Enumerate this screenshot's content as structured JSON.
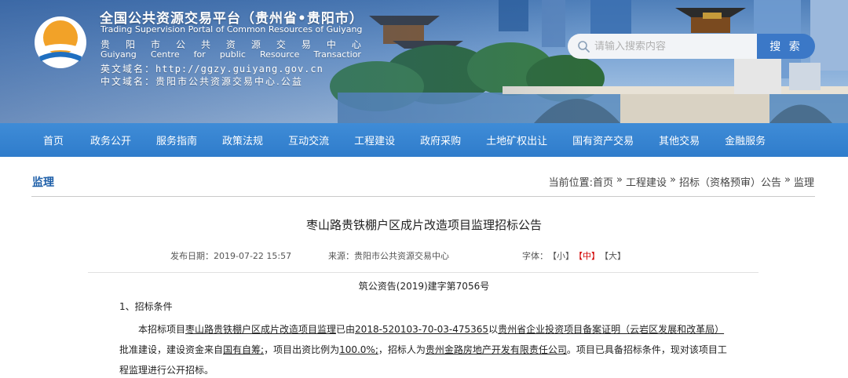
{
  "header": {
    "title_cn": "全国公共资源交易平台（贵州省•贵阳市）",
    "title_en": "Trading Supervision Portal of Common Resources of Guiyang",
    "center_cn": [
      "贵",
      "阳",
      "市",
      "公",
      "共",
      "资",
      "源",
      "交",
      "易",
      "中",
      "心"
    ],
    "center_en": [
      "Guiyang",
      "Centre",
      "for",
      "public",
      "Resource",
      "Transactior"
    ],
    "en_domain_label": "英文域名：",
    "en_domain_value": "http://ggzy.guiyang.gov.cn",
    "cn_domain_label": "中文域名：",
    "cn_domain_value": "贵阳市公共资源交易中心.公益"
  },
  "search": {
    "placeholder": "请输入搜索内容",
    "button_label": "搜 索"
  },
  "nav": [
    "首页",
    "政务公开",
    "服务指南",
    "政策法规",
    "互动交流",
    "工程建设",
    "政府采购",
    "土地矿权出让",
    "国有资产交易",
    "其他交易",
    "金融服务"
  ],
  "section": {
    "title": "监理"
  },
  "breadcrumb": {
    "prefix": "当前位置:",
    "items": [
      "首页",
      "»",
      "工程建设",
      "»",
      "招标（资格预审）公告",
      "»",
      "监理"
    ]
  },
  "article": {
    "title": "枣山路贵铁棚户区成片改造项目监理招标公告",
    "publish_label": "发布日期：",
    "publish_value": "2019-07-22 15:57",
    "source_label": "来源：",
    "source_value": "贵阳市公共资源交易中心",
    "font_label": "字体：",
    "font_small": "【小】",
    "font_medium": "【中】",
    "font_large": "【大】",
    "doc_no": "筑公资告(2019)建字第7056号",
    "section1": "1、招标条件",
    "p1": "本招标项目",
    "p2": "枣山路贵铁棚户区成片改造项目监理",
    "p3": "已由",
    "p4": "2018-520103-70-03-475365",
    "p5": "以",
    "p6": "贵州省企业投资项目备案证明（云岩区发展和改革局）",
    "p7": "批准建设，建设资金来自",
    "p8": "国有自筹;",
    "p9": "，项目出资比例为",
    "p10": "100.0%;",
    "p11": "，招标人为",
    "p12": "贵州金路房地产开发有限责任公司",
    "p13": "。项目已具备招标条件，现对该项目工程监理进行公开招标。"
  },
  "colors": {
    "nav_bg": "#2f7ccb",
    "search_button": "#3b78c7",
    "section_title": "#1d5ea8",
    "active_font_size": "#d20000"
  },
  "icons": [
    "logo-emblem",
    "search-icon"
  ]
}
